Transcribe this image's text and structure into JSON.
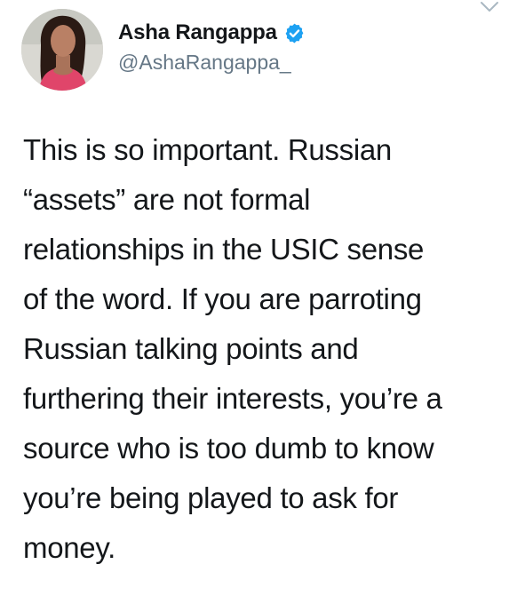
{
  "author": {
    "display_name": "Asha Rangappa",
    "handle": "@AshaRangappa_",
    "verified_icon": "verified-badge-icon",
    "avatar": "profile-photo"
  },
  "menu": {
    "icon": "chevron-down-icon"
  },
  "tweet": {
    "lines": [
      "This is so important. Russian",
      "“assets” are not formal",
      "relationships in the USIC sense",
      "of the word. If you are parroting",
      "Russian talking points and",
      "furthering their interests, you’re a",
      "source who is too dumb to know",
      "you’re being played to ask for",
      "money."
    ]
  },
  "colors": {
    "text": "#14171a",
    "secondary": "#657786",
    "verified": "#1da1f2"
  }
}
